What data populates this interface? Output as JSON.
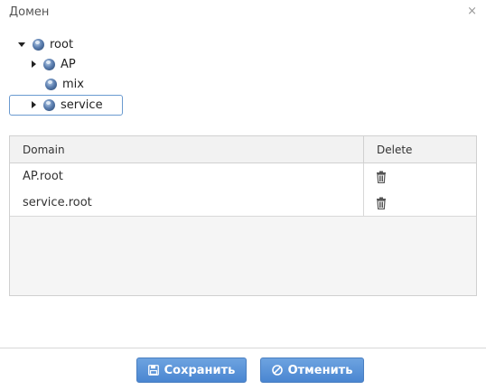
{
  "dialog": {
    "title": "Домен",
    "close_glyph": "×"
  },
  "tree": {
    "items": [
      {
        "label": "root",
        "state": "expanded",
        "icon": "globe-icon"
      },
      {
        "label": "AP",
        "state": "collapsed",
        "icon": "globe-icon"
      },
      {
        "label": "mix",
        "state": "leaf",
        "icon": "globe-icon"
      },
      {
        "label": "service",
        "state": "collapsed",
        "icon": "globe-icon",
        "selected": true
      }
    ]
  },
  "table": {
    "headers": [
      "Domain",
      "Delete"
    ],
    "rows": [
      {
        "domain": "AP.root",
        "delete_icon": "trash-icon"
      },
      {
        "domain": "service.root",
        "delete_icon": "trash-icon"
      }
    ]
  },
  "buttons": {
    "save": {
      "label": "Сохранить",
      "icon": "floppy-disk-icon"
    },
    "cancel": {
      "label": "Отменить",
      "icon": "ban-icon"
    }
  },
  "colors": {
    "button_blue": "#4a86d1",
    "selection_border": "#6a9ad0"
  }
}
